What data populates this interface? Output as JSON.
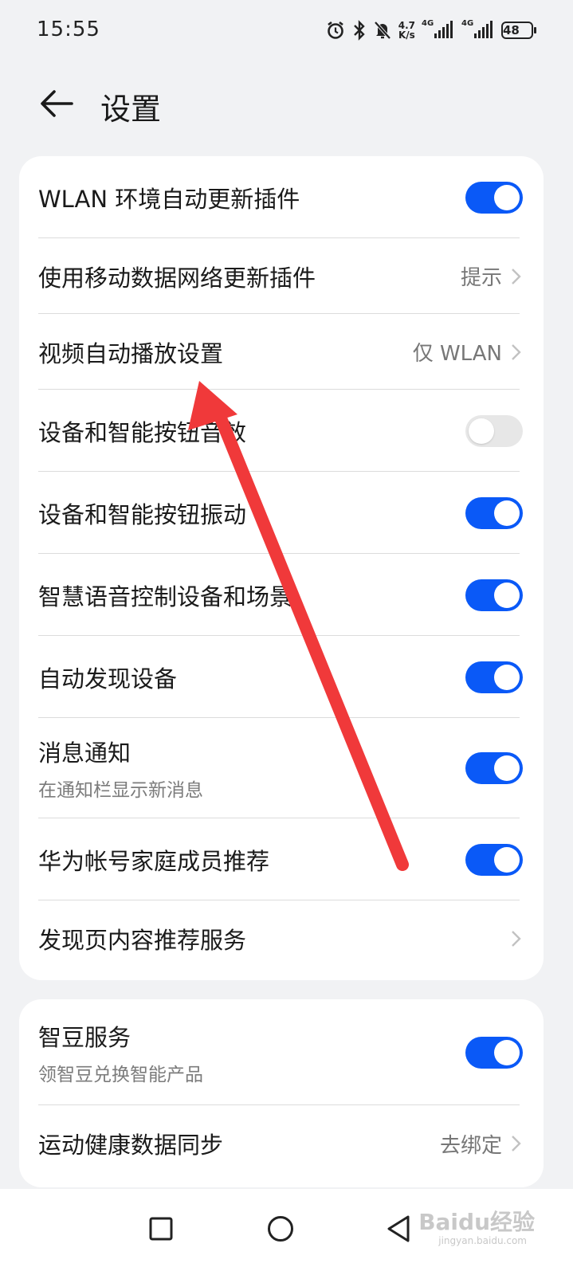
{
  "status_bar": {
    "time": "15:55",
    "net_speed_value": "4.7",
    "net_speed_unit": "K/s",
    "signal_1_label": "4G",
    "signal_2_label": "4G",
    "battery": "48",
    "icons": [
      "alarm-icon",
      "bluetooth-icon",
      "mute-icon"
    ]
  },
  "header": {
    "title": "设置",
    "back_icon": "back-arrow-icon"
  },
  "card1": {
    "rows": [
      {
        "title": "WLAN 环境自动更新插件",
        "control": "toggle",
        "on": true
      },
      {
        "title": "使用移动数据网络更新插件",
        "value": "提示",
        "control": "chevron"
      },
      {
        "title": "视频自动播放设置",
        "value": "仅 WLAN",
        "control": "chevron"
      },
      {
        "title": "设备和智能按钮音效",
        "control": "toggle",
        "on": false
      },
      {
        "title": "设备和智能按钮振动",
        "control": "toggle",
        "on": true
      },
      {
        "title": "智慧语音控制设备和场景",
        "control": "toggle",
        "on": true
      },
      {
        "title": "自动发现设备",
        "control": "toggle",
        "on": true
      },
      {
        "title": "消息通知",
        "subtitle": "在通知栏显示新消息",
        "control": "toggle",
        "on": true
      },
      {
        "title": "华为帐号家庭成员推荐",
        "control": "toggle",
        "on": true
      },
      {
        "title": "发现页内容推荐服务",
        "control": "chevron"
      }
    ]
  },
  "card2": {
    "rows": [
      {
        "title": "智豆服务",
        "subtitle": "领智豆兑换智能产品",
        "control": "toggle",
        "on": true
      },
      {
        "title": "运动健康数据同步",
        "value": "去绑定",
        "control": "chevron"
      }
    ]
  },
  "annotation": {
    "color": "#f0393a",
    "icon": "red-arrow-annotation"
  },
  "nav_bar": {
    "icons": [
      "recent-apps-icon",
      "home-icon",
      "back-triangle-icon"
    ],
    "watermark": "Baidu经验",
    "watermark_sub": "jingyan.baidu.com"
  },
  "colors": {
    "accent": "#0a59f7",
    "background": "#f1f2f4",
    "card": "#ffffff"
  }
}
